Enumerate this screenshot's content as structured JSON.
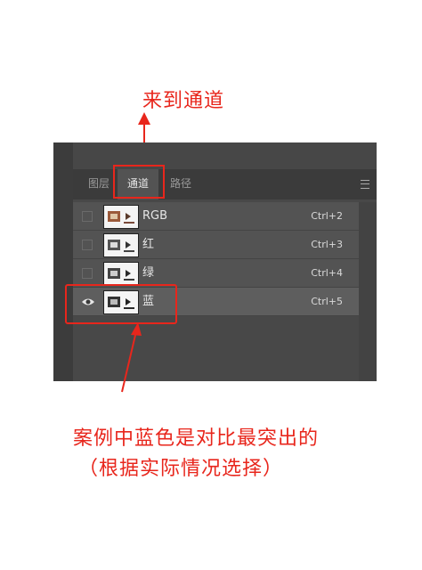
{
  "annotations": {
    "top": "来到通道",
    "note_line1": "案例中蓝色是对比最突出的",
    "note_line2": "（根据实际情况选择）",
    "color": "#e8261c"
  },
  "panel": {
    "tabs": [
      {
        "label": "图层",
        "active": false
      },
      {
        "label": "通道",
        "active": true
      },
      {
        "label": "路径",
        "active": false
      }
    ],
    "menu_icon": "hamburger-menu-icon",
    "channels": [
      {
        "name": "RGB",
        "shortcut": "Ctrl+2",
        "visible": false,
        "selected": false
      },
      {
        "name": "红",
        "shortcut": "Ctrl+3",
        "visible": false,
        "selected": false
      },
      {
        "name": "绿",
        "shortcut": "Ctrl+4",
        "visible": false,
        "selected": false
      },
      {
        "name": "蓝",
        "shortcut": "Ctrl+5",
        "visible": true,
        "selected": true
      }
    ]
  }
}
